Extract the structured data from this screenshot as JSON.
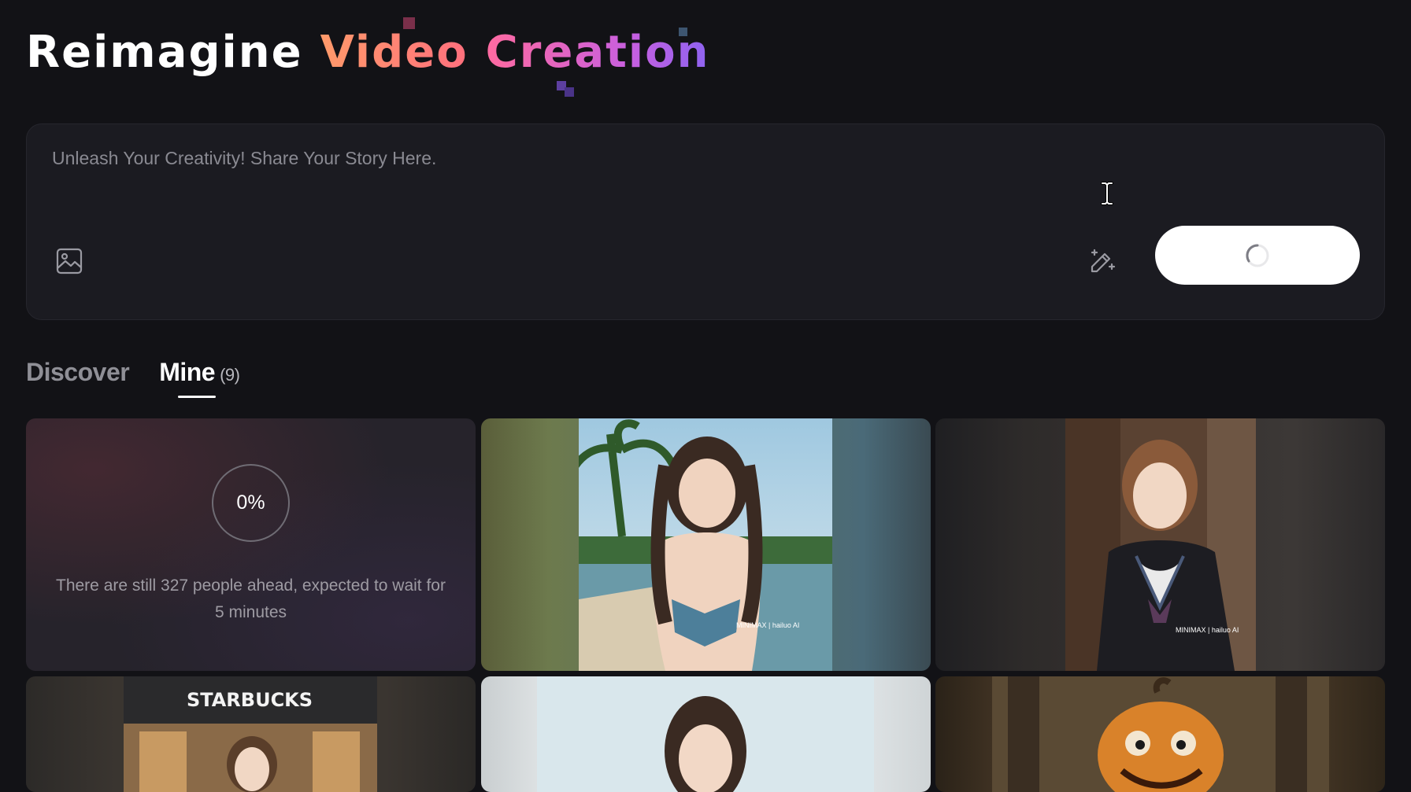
{
  "hero": {
    "word1": "Reimagine",
    "word2": "Video",
    "word3": "Creation"
  },
  "prompt": {
    "placeholder": "Unleash Your Creativity! Share Your Story Here.",
    "value": ""
  },
  "tabs": {
    "discover": "Discover",
    "mine": "Mine",
    "mine_count": "(9)",
    "active": "Mine"
  },
  "queue": {
    "percent": "0%",
    "message": "There are still 327 people ahead, expected to wait for 5 minutes"
  },
  "cards": [
    {
      "kind": "queue"
    },
    {
      "kind": "video",
      "subject": "woman-bikini-beach",
      "watermark": "MINIMAX | hailuo AI"
    },
    {
      "kind": "video",
      "subject": "woman-sailor-uniform-window",
      "watermark": "MINIMAX | hailuo AI"
    },
    {
      "kind": "video",
      "subject": "woman-starbucks-storefront",
      "sign_text": "STARBUCKS"
    },
    {
      "kind": "video",
      "subject": "woman-beach-portrait"
    },
    {
      "kind": "video",
      "subject": "jack-o-lantern-pumpkin"
    }
  ],
  "colors": {
    "background": "#121216",
    "panel": "#1b1b21",
    "title_gradient_video": [
      "#ff9a6a",
      "#ff6f7d"
    ],
    "title_gradient_creation": [
      "#ff6aa0",
      "#c75fe0",
      "#8d63f0"
    ]
  }
}
